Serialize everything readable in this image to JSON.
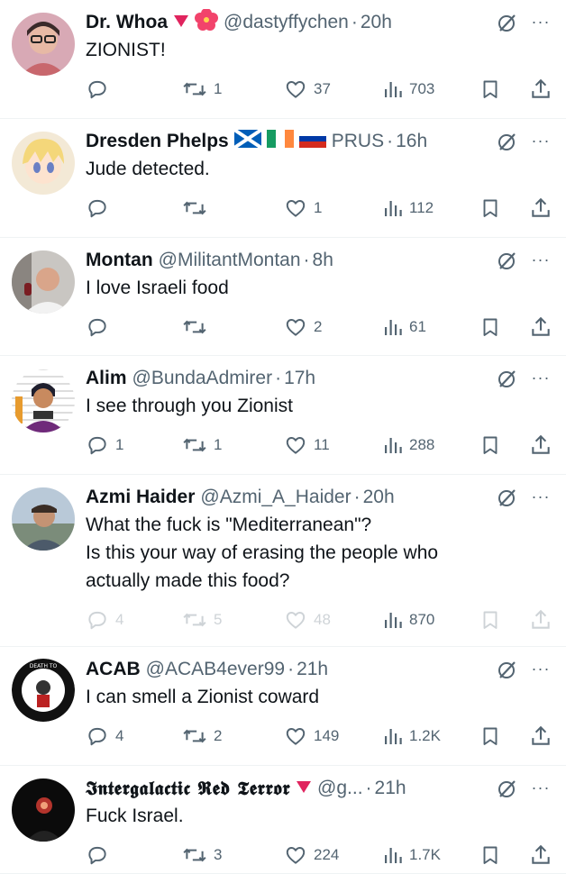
{
  "tweets": [
    {
      "name": "Dr. Whoa",
      "badges": [
        "red-triangle",
        "hibiscus"
      ],
      "handle": "@dastyffychen",
      "dot": "·",
      "time": "20h",
      "text": [
        "ZIONIST!"
      ],
      "reply_count": "",
      "retweet_count": "1",
      "like_count": "37",
      "view_count": "703"
    },
    {
      "name": "Dresden Phelps",
      "badges": [
        "scotland-flag",
        "ireland-flag",
        "russia-flag"
      ],
      "handle": "PRUS",
      "dot": "·",
      "time": "16h",
      "text": [
        "Jude detected."
      ],
      "reply_count": "",
      "retweet_count": "",
      "like_count": "1",
      "view_count": "112"
    },
    {
      "name": "Montan",
      "badges": [],
      "handle": "@MilitantMontan",
      "dot": "·",
      "time": "8h",
      "text": [
        "I love Israeli food"
      ],
      "reply_count": "",
      "retweet_count": "",
      "like_count": "2",
      "view_count": "61"
    },
    {
      "name": "Alim",
      "badges": [],
      "handle": "@BundaAdmirer",
      "dot": "·",
      "time": "17h",
      "text": [
        "I see through you Zionist"
      ],
      "reply_count": "1",
      "retweet_count": "1",
      "like_count": "11",
      "view_count": "288"
    },
    {
      "name": "Azmi Haider",
      "badges": [],
      "handle": "@Azmi_A_Haider",
      "dot": "·",
      "time": "20h",
      "text": [
        "What the fuck is \"Mediterranean\"?",
        "Is this your way of erasing the people who",
        "actually made this food?"
      ],
      "reply_count": "4",
      "retweet_count": "5",
      "like_count": "48",
      "view_count": "870",
      "faded": true
    },
    {
      "name": "ACAB",
      "badges": [],
      "handle": "@ACAB4ever99",
      "dot": "·",
      "time": "21h",
      "text": [
        "I can smell a Zionist coward"
      ],
      "reply_count": "4",
      "retweet_count": "2",
      "like_count": "149",
      "view_count": "1.2K"
    },
    {
      "name": "𝕴𝖓𝖙𝖊𝖗𝖌𝖆𝖑𝖆𝖈𝖙𝖎𝖈 𝕽𝖊𝖉 𝕿𝖊𝖗𝖗𝖔𝖗",
      "badges": [
        "red-triangle"
      ],
      "handle": "@g...",
      "dot": "·",
      "time": "21h",
      "text": [
        "Fuck Israel."
      ],
      "reply_count": "",
      "retweet_count": "3",
      "like_count": "224",
      "view_count": "1.7K"
    }
  ],
  "more_label": "···",
  "colors": {
    "text": "#0f1419",
    "muted": "#536471",
    "divider": "#eff3f4",
    "red": "#e0245e"
  }
}
